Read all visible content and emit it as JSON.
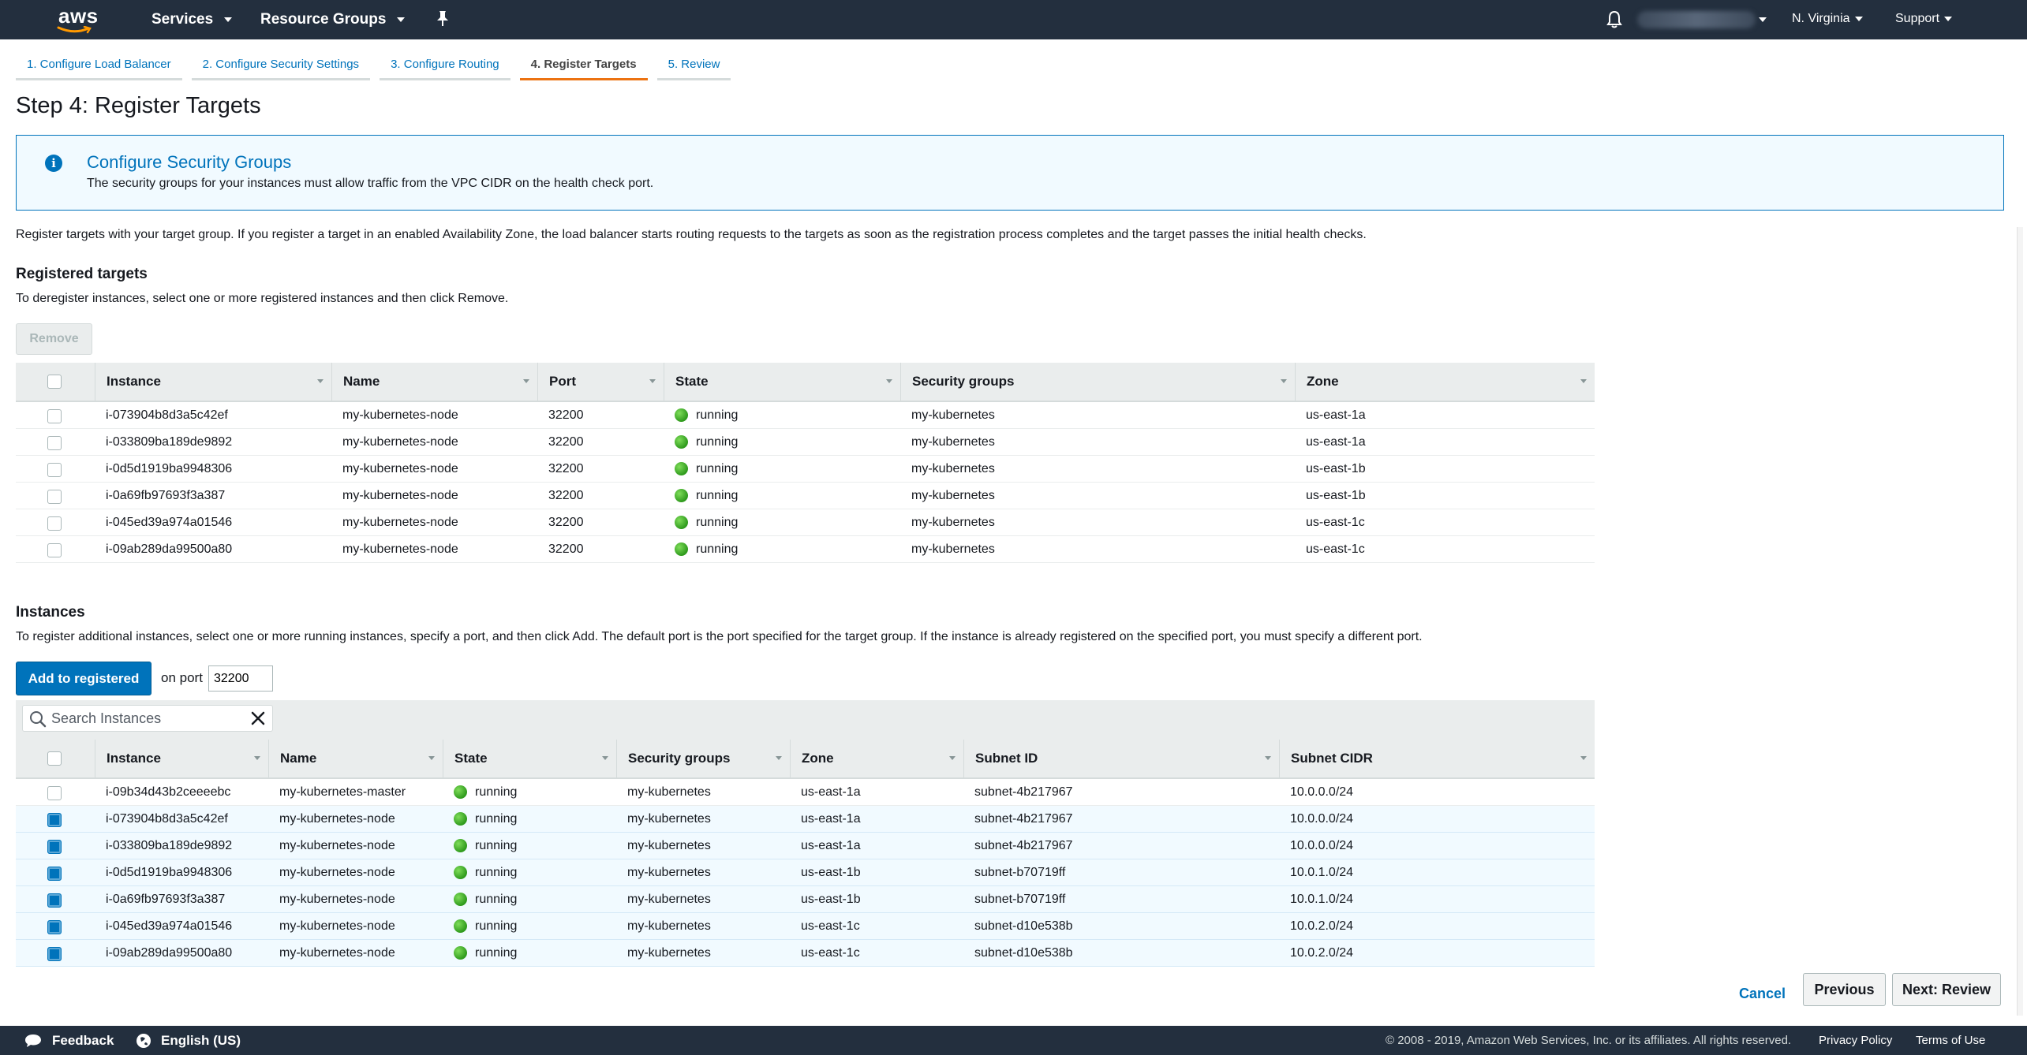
{
  "nav": {
    "logo_text": "aws",
    "services_label": "Services",
    "resource_groups_label": "Resource Groups",
    "region_label": "N. Virginia",
    "support_label": "Support"
  },
  "tabs": [
    {
      "label": "1. Configure Load Balancer"
    },
    {
      "label": "2. Configure Security Settings"
    },
    {
      "label": "3. Configure Routing"
    },
    {
      "label": "4. Register Targets"
    },
    {
      "label": "5. Review"
    }
  ],
  "page_title": "Step 4: Register Targets",
  "alert": {
    "title": "Configure Security Groups",
    "body": "The security groups for your instances must allow traffic from the VPC CIDR on the health check port.",
    "icon": "info-icon"
  },
  "description": "Register targets with your target group. If you register a target in an enabled Availability Zone, the load balancer starts routing requests to the targets as soon as the registration process completes and the target passes the initial health checks.",
  "registered": {
    "title": "Registered targets",
    "subtitle": "To deregister instances, select one or more registered instances and then click Remove.",
    "remove_label": "Remove",
    "columns": [
      "Instance",
      "Name",
      "Port",
      "State",
      "Security groups",
      "Zone"
    ],
    "rows": [
      {
        "instance": "i-073904b8d3a5c42ef",
        "name": "my-kubernetes-node",
        "port": "32200",
        "state": "running",
        "sg": "my-kubernetes",
        "zone": "us-east-1a"
      },
      {
        "instance": "i-033809ba189de9892",
        "name": "my-kubernetes-node",
        "port": "32200",
        "state": "running",
        "sg": "my-kubernetes",
        "zone": "us-east-1a"
      },
      {
        "instance": "i-0d5d1919ba9948306",
        "name": "my-kubernetes-node",
        "port": "32200",
        "state": "running",
        "sg": "my-kubernetes",
        "zone": "us-east-1b"
      },
      {
        "instance": "i-0a69fb97693f3a387",
        "name": "my-kubernetes-node",
        "port": "32200",
        "state": "running",
        "sg": "my-kubernetes",
        "zone": "us-east-1b"
      },
      {
        "instance": "i-045ed39a974a01546",
        "name": "my-kubernetes-node",
        "port": "32200",
        "state": "running",
        "sg": "my-kubernetes",
        "zone": "us-east-1c"
      },
      {
        "instance": "i-09ab289da99500a80",
        "name": "my-kubernetes-node",
        "port": "32200",
        "state": "running",
        "sg": "my-kubernetes",
        "zone": "us-east-1c"
      }
    ]
  },
  "instances": {
    "title": "Instances",
    "subtitle": "To register additional instances, select one or more running instances, specify a port, and then click Add. The default port is the port specified for the target group. If the instance is already registered on the specified port, you must specify a different port.",
    "add_label": "Add to registered",
    "on_port_label": "on port",
    "port_value": "32200",
    "search_placeholder": "Search Instances",
    "columns": [
      "Instance",
      "Name",
      "State",
      "Security groups",
      "Zone",
      "Subnet ID",
      "Subnet CIDR"
    ],
    "rows": [
      {
        "selected": false,
        "instance": "i-09b34d43b2ceeeebc",
        "name": "my-kubernetes-master",
        "state": "running",
        "sg": "my-kubernetes",
        "zone": "us-east-1a",
        "subnet": "subnet-4b217967",
        "cidr": "10.0.0.0/24"
      },
      {
        "selected": true,
        "instance": "i-073904b8d3a5c42ef",
        "name": "my-kubernetes-node",
        "state": "running",
        "sg": "my-kubernetes",
        "zone": "us-east-1a",
        "subnet": "subnet-4b217967",
        "cidr": "10.0.0.0/24"
      },
      {
        "selected": true,
        "instance": "i-033809ba189de9892",
        "name": "my-kubernetes-node",
        "state": "running",
        "sg": "my-kubernetes",
        "zone": "us-east-1a",
        "subnet": "subnet-4b217967",
        "cidr": "10.0.0.0/24"
      },
      {
        "selected": true,
        "instance": "i-0d5d1919ba9948306",
        "name": "my-kubernetes-node",
        "state": "running",
        "sg": "my-kubernetes",
        "zone": "us-east-1b",
        "subnet": "subnet-b70719ff",
        "cidr": "10.0.1.0/24"
      },
      {
        "selected": true,
        "instance": "i-0a69fb97693f3a387",
        "name": "my-kubernetes-node",
        "state": "running",
        "sg": "my-kubernetes",
        "zone": "us-east-1b",
        "subnet": "subnet-b70719ff",
        "cidr": "10.0.1.0/24"
      },
      {
        "selected": true,
        "instance": "i-045ed39a974a01546",
        "name": "my-kubernetes-node",
        "state": "running",
        "sg": "my-kubernetes",
        "zone": "us-east-1c",
        "subnet": "subnet-d10e538b",
        "cidr": "10.0.2.0/24"
      },
      {
        "selected": true,
        "instance": "i-09ab289da99500a80",
        "name": "my-kubernetes-node",
        "state": "running",
        "sg": "my-kubernetes",
        "zone": "us-east-1c",
        "subnet": "subnet-d10e538b",
        "cidr": "10.0.2.0/24"
      }
    ]
  },
  "actions": {
    "cancel": "Cancel",
    "previous": "Previous",
    "next": "Next: Review"
  },
  "footer": {
    "feedback": "Feedback",
    "language": "English (US)",
    "copyright": "© 2008 - 2019, Amazon Web Services, Inc. or its affiliates. All rights reserved.",
    "privacy": "Privacy Policy",
    "terms": "Terms of Use"
  },
  "colors": {
    "nav_bg": "#232f3e",
    "accent_blue": "#0073bb",
    "active_tab": "#ec7211",
    "running_green": "#3bab2c"
  }
}
